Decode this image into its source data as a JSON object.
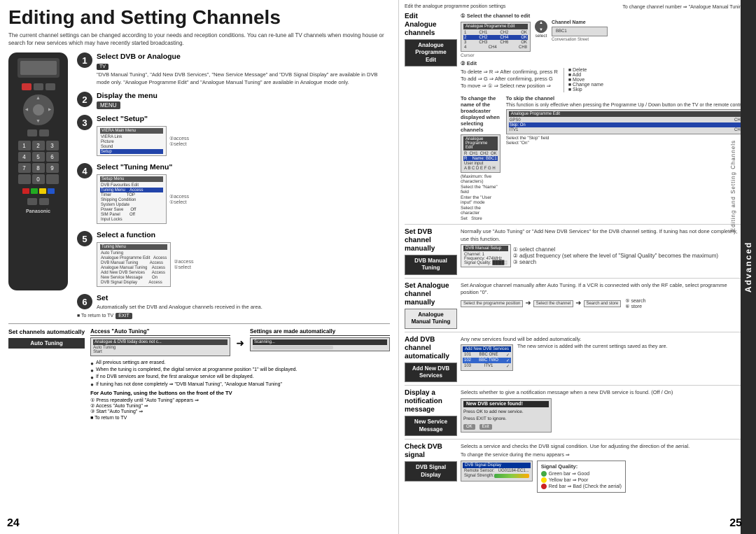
{
  "page": {
    "title": "Editing and Setting Channels",
    "intro": "The current channel settings can be changed according to your needs and reception conditions. You can re-tune all TV channels when moving house or search for new services which may have recently started broadcasting.",
    "page_left": "24",
    "page_right": "25",
    "advanced_label": "Advanced",
    "vertical_label": "Editing and Setting Channels"
  },
  "steps": [
    {
      "num": "1",
      "title": "Select DVB or Analogue",
      "desc": "\"DVB Manual Tuning\", \"Add New DVB Services\", \"New Service Message\" and \"DVB Signal Display\" are available in DVB mode only. \"Analogue Programme Edit\" and \"Analogue Manual Tuning\" are available in Analogue mode only."
    },
    {
      "num": "2",
      "title": "Display the menu",
      "desc": "MENU"
    },
    {
      "num": "3",
      "title": "Select \"Setup\"",
      "desc": "access / select"
    },
    {
      "num": "4",
      "title": "Select \"Tuning Menu\"",
      "desc": "access / select"
    },
    {
      "num": "5",
      "title": "Select a function",
      "desc": "access / select"
    },
    {
      "num": "6",
      "title": "Set",
      "desc": ""
    }
  ],
  "menus": {
    "main_menu": {
      "title": "VIERA Main Menu",
      "items": [
        "VIERA Link",
        "Picture",
        "Sound",
        "Setup"
      ]
    },
    "setup_menu": {
      "title": "Setup Menu",
      "items": [
        "DVB Favourites Edit",
        "Tuning Menu",
        "Timer",
        "Shipping Condition",
        "System Update",
        "Power Save",
        "SIM Panel",
        "Input Locks"
      ]
    },
    "tuning_menu": {
      "title": "Tuning Menu",
      "items": [
        "Auto Tuning",
        "Analogue Programme Edit",
        "DVB Manual Tuning",
        "Analogue Manual Tuning",
        "Add New DVB Services",
        "New Service Message",
        "DVB Signal Display"
      ]
    }
  },
  "set_channels": {
    "label": "Set channels automatically",
    "badge": "Auto Tuning",
    "auto_tuning_desc": "Automatically set the DVB and Analogue channels received in the area.",
    "access_title": "Access \"Auto Tuning\"",
    "settings_title": "Settings are made automatically",
    "bullets": [
      "All previous settings are erased.",
      "When the tuning is completed, the digital service at programme position \"1\" will be displayed.",
      "If no DVB services are found, the first analogue service will be displayed.",
      "If tuning has not done completely ⇒ \"DVB Manual Tuning\", \"Analogue Manual Tuning\""
    ],
    "front_tv_note": "For Auto Tuning, using the buttons on the front of the TV",
    "step1": "① Press repeatedly until \"Auto Tuning\" appears ⇒",
    "step2": "② Access \"Auto Tuning\" ⇒",
    "step3": "③ Start \"Auto Tuning\" ⇒",
    "to_return_tv": "■ To return to TV"
  },
  "right_panel": {
    "top_note_left": "Edit the analogue programme position settings",
    "top_note_right": "To change channel number ⇒ \"Analogue Manual Tuning\"",
    "step1_label": "① Select the channel to edit",
    "cursor_label": "Cursor",
    "select_label": "select",
    "channel_name_label": "Channel Name",
    "step2_label": "② Edit",
    "edit_analogue": {
      "title": "Edit Analogue channels",
      "label_box": "Analogue Programme Edit"
    },
    "to_delete": "To delete ⇒ R ⇒ After confirming, press R",
    "to_add": "To add ⇒ G ⇒ After confirming, press G",
    "to_move": "To move ⇒ ① ⇒ Select new position ⇒",
    "change_name_title": "To change the name of the broadcaster displayed when selecting channels",
    "change_name_steps": [
      "Select the \"Name\" field",
      "Enter the \"User input\" mode",
      "(Maximum: five characters)",
      "Select the character",
      "Set",
      "Store"
    ],
    "skip_title": "To skip the channel",
    "skip_desc": "This function is only effective when pressing the Programme Up / Down button on the TV or the remote control.",
    "skip_steps": [
      "Select the \"Skip\" field",
      "Select \"On\""
    ],
    "delete_label": "■ Delete",
    "add_label": "■ Add",
    "move_label": "■ Move",
    "change_label": "■ Change name",
    "skip_label": "■ Skip"
  },
  "set_dvb": {
    "title": "Set DVB channel manually",
    "label_box": "DVB Manual Tuning",
    "desc": "Normally use \"Auto Tuning\" or \"Add New DVB Services\" for the DVB channel setting. If tuning has not done completely, use this function.",
    "steps": [
      "① select channel",
      "② adjust frequency (set where the level of \"Signal Quality\" becomes the maximum)",
      "③ search"
    ]
  },
  "set_analogue": {
    "title": "Set Analogue channel manually",
    "desc": "Set Analogue channel manually after Auto Tuning. If a VCR is connected with only the RF cable, select programme position \"0\".",
    "label_box": "Analogue Manual Tuning",
    "flow": "Select the programme position → Select the channel → Search and store",
    "search_label": "⑤ search",
    "store_label": "⑥ store"
  },
  "add_dvb": {
    "title": "Add DVB channel automatically",
    "label_box": "Add New DVB Services",
    "desc": "Any new services found will be added automatically.",
    "note": "The new service is added with the current settings saved as they are."
  },
  "display_notification": {
    "title": "Display a notification message",
    "label_box": "New Service Message",
    "desc": "Selects whether to give a notification message when a new DVB service is found. (Off / On)",
    "screen_title": "New DVB service found!",
    "screen_body": "Press OK to add new service.\nPress EXIT to ignore.",
    "ok_btn": "OK",
    "exit_btn": "Exit"
  },
  "check_dvb": {
    "title": "Check DVB signal",
    "label_box": "DVB Signal Display",
    "desc": "Selects a service and checks the DVB signal condition. Use for adjusting the direction of the aerial.",
    "change_note": "To change the service during the menu appears ⇒",
    "signal_quality": {
      "title": "Signal Quality:",
      "items": [
        {
          "color": "#44aa44",
          "text": "Green bar ⇒ Good"
        },
        {
          "color": "#ffdd00",
          "text": "Yellow bar ⇒ Poor"
        },
        {
          "color": "#cc2222",
          "text": "Red bar ⇒ Bad (Check the aerial)"
        }
      ]
    }
  },
  "to_return_tv": "■ To return to TV"
}
